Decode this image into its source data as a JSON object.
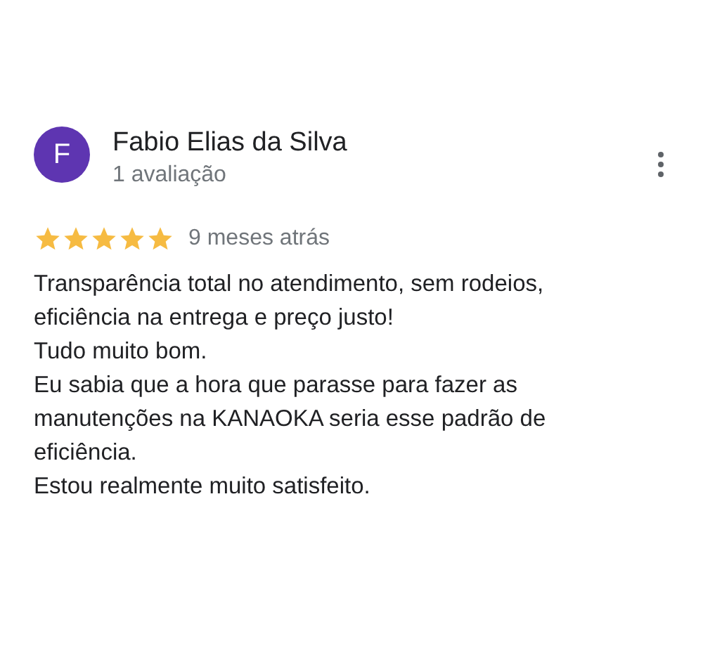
{
  "review": {
    "avatar_letter": "F",
    "author": "Fabio Elias da Silva",
    "author_meta": "1 avaliação",
    "stars": 5,
    "time": "9 meses atrás",
    "lines": [
      "Transparência total no atendimento, sem rodeios, eficiência na entrega e preço justo!",
      "Tudo muito bom.",
      "Eu sabia que a hora que parasse para fazer as manutenções na KANAOKA seria esse padrão de eficiência.",
      "Estou realmente muito satisfeito."
    ]
  }
}
